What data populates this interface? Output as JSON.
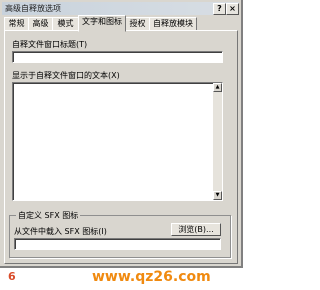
{
  "window": {
    "title": "高级自释放选项",
    "help_button": "?",
    "close_button": "×"
  },
  "tabs": [
    {
      "label": "常规"
    },
    {
      "label": "高级"
    },
    {
      "label": "模式"
    },
    {
      "label": "文字和图标"
    },
    {
      "label": "授权"
    },
    {
      "label": "自释放模块"
    }
  ],
  "active_tab": "文字和图标",
  "window_title_field": {
    "label": "自释文件窗口标题(T)",
    "value": ""
  },
  "text_field": {
    "label": "显示于自释文件窗口的文本(X)",
    "value": ""
  },
  "sfx_icon": {
    "group_title": "自定义 SFX 图标",
    "label": "从文件中载入 SFX 图标(I)",
    "value": "",
    "browse_button": "浏览(B)..."
  },
  "figure_number": "6",
  "watermark": "www.qz26.com"
}
